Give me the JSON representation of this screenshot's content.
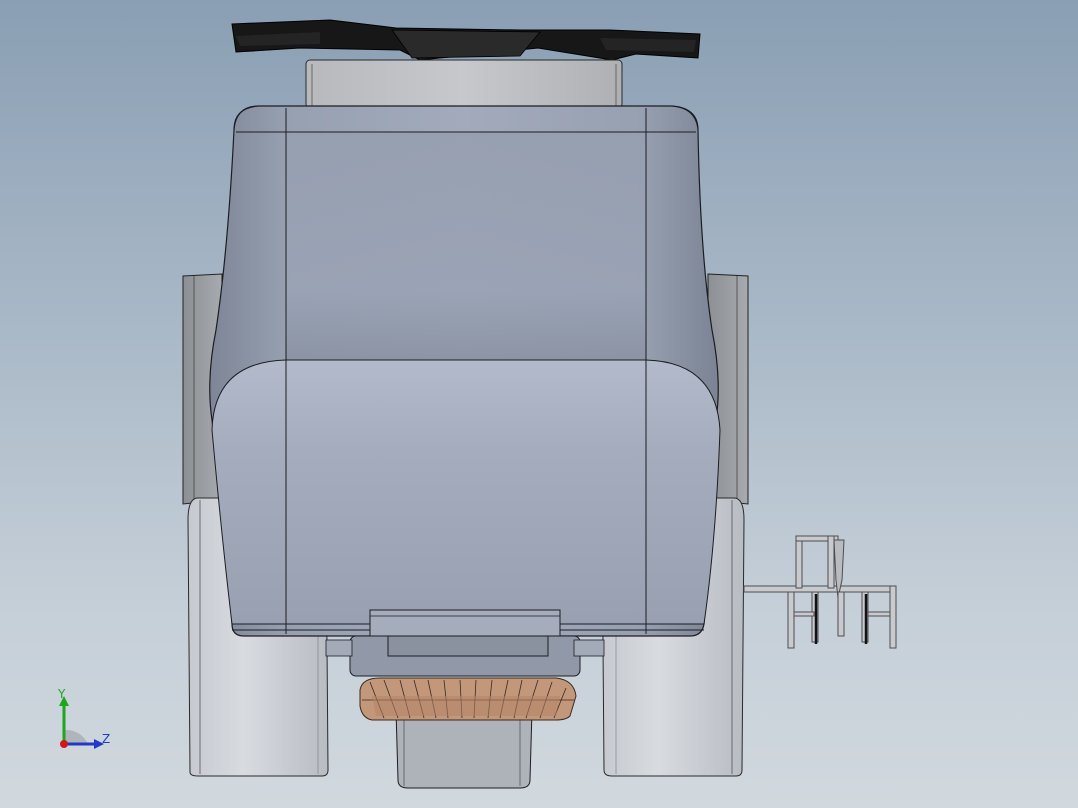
{
  "viewport": {
    "background_top": "#8a9fb4",
    "background_bottom": "#d1d8de"
  },
  "model": {
    "description_icon": "ride-on-floor-scrubber-3d-model",
    "colors": {
      "body": "#9aa3b3",
      "body_highlight": "#b4bccb",
      "outline": "#1c1d22",
      "seat": "#1a1a1a",
      "tire": "#c9cdd3",
      "tire_shadow": "#9fa4ab",
      "brush": "#c89a7a",
      "frame": "#8a8d92"
    }
  },
  "triad": {
    "y_label": "Y",
    "z_label": "Z",
    "y_color": "#1fa51f",
    "z_color": "#2338c9",
    "x_color": "#d01818"
  }
}
